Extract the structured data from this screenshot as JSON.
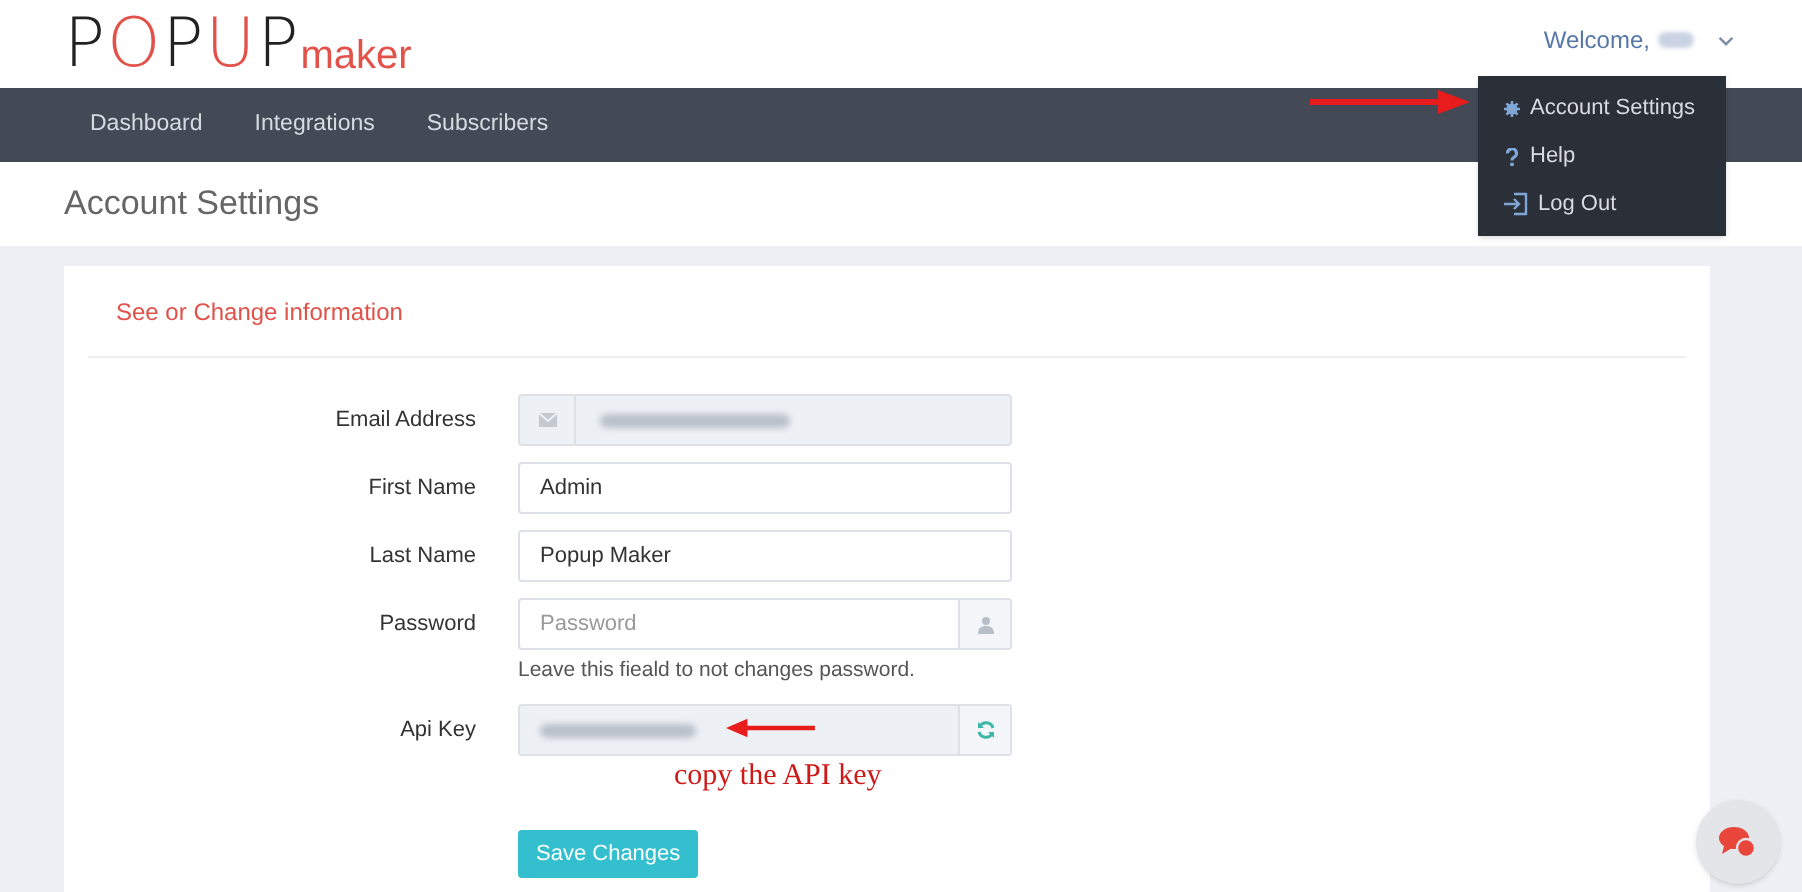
{
  "logo": {
    "word": "POPUP",
    "suffix": "maker"
  },
  "user_menu": {
    "greeting": "Welcome,",
    "expanded": true
  },
  "nav": [
    {
      "label": "Dashboard"
    },
    {
      "label": "Integrations"
    },
    {
      "label": "Subscribers"
    }
  ],
  "dropdown": [
    {
      "kind": "gear",
      "label": "Account Settings"
    },
    {
      "kind": "help",
      "label": "Help"
    },
    {
      "kind": "logout",
      "label": "Log Out"
    }
  ],
  "page_title": "Account Settings",
  "card": {
    "heading": "See or Change information",
    "fields": [
      {
        "label": "Email Address",
        "kind": "email",
        "disabled": true
      },
      {
        "label": "First Name",
        "kind": "text",
        "value": "Admin",
        "disabled": false
      },
      {
        "label": "Last Name",
        "kind": "text",
        "value": "Popup Maker",
        "disabled": false
      },
      {
        "label": "Password",
        "kind": "password",
        "placeholder": "Password",
        "help": "Leave this fieald to not changes password.",
        "disabled": false
      },
      {
        "label": "Api Key",
        "kind": "apikey",
        "disabled": true,
        "annotation": "copy the API key"
      }
    ],
    "button": "Save Changes"
  }
}
